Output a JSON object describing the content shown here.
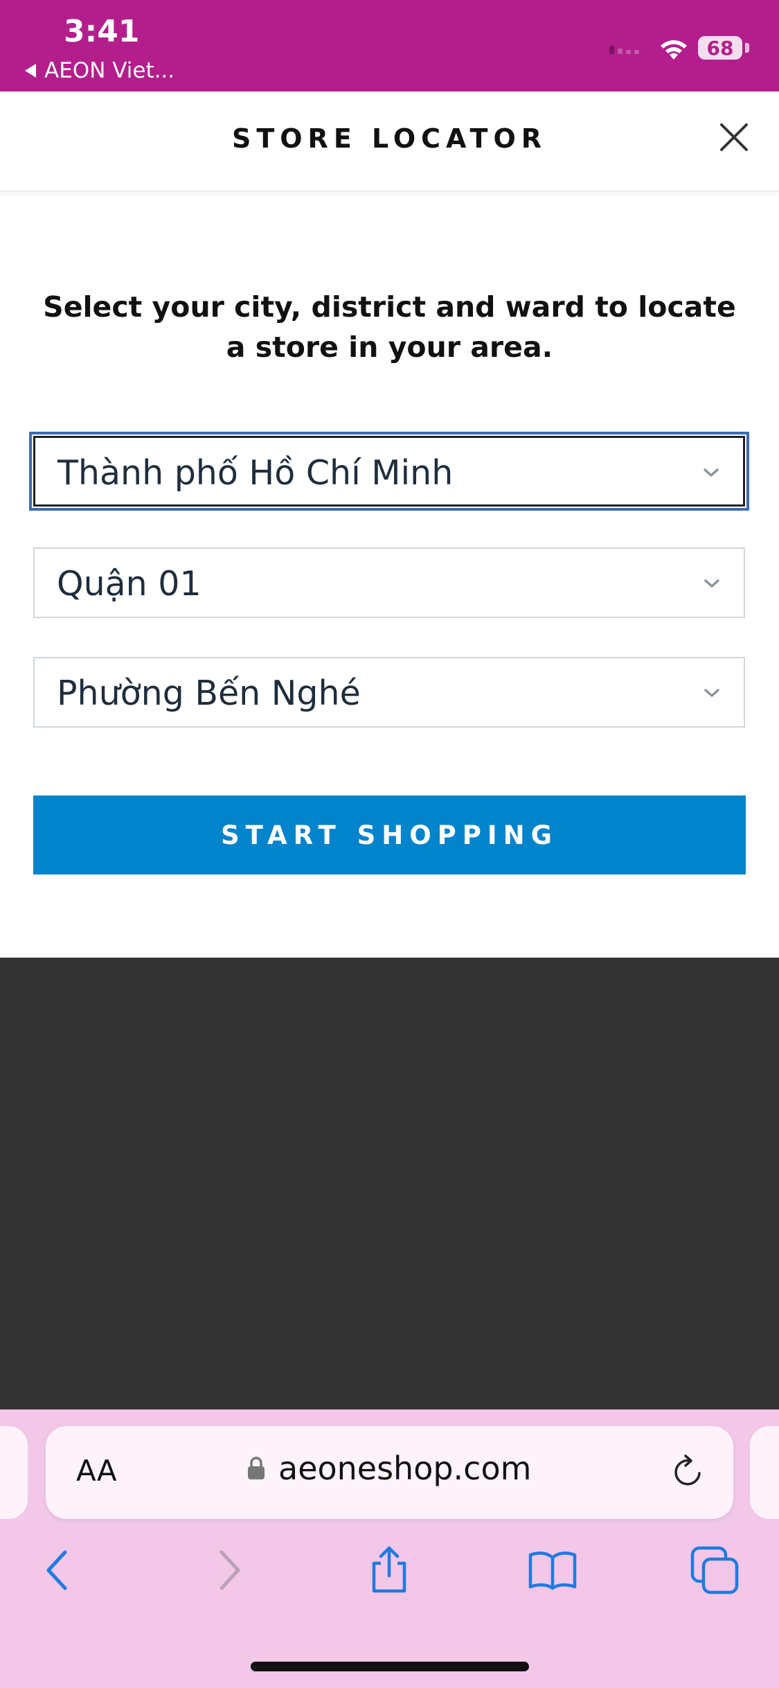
{
  "status_bar": {
    "time": "3:41",
    "back_app": "AEON Viet...",
    "battery": "68"
  },
  "modal": {
    "title": "STORE LOCATOR",
    "instruction": "Select your city, district and ward to locate a store in your area.",
    "city_select": {
      "value": "Thành phố Hồ Chí Minh"
    },
    "district_select": {
      "value": "Quận 01"
    },
    "ward_select": {
      "value": "Phường Bến Nghé"
    },
    "start_button": "START SHOPPING"
  },
  "browser": {
    "text_size_label": "AA",
    "url": "aeoneshop.com"
  },
  "icons": {
    "close": "close-icon",
    "chevron": "chevron-down-icon",
    "lock": "lock-icon",
    "reload": "reload-icon",
    "back": "back-arrow-icon",
    "forward": "forward-arrow-icon",
    "share": "share-icon",
    "bookmarks": "bookmarks-icon",
    "tabs": "tabs-icon"
  },
  "colors": {
    "status_bar": "#b31e8c",
    "primary_button": "#0184cc",
    "focus_ring": "#3d6bb3",
    "overlay": "#333333",
    "browser_chrome": "#f2c7e8"
  }
}
